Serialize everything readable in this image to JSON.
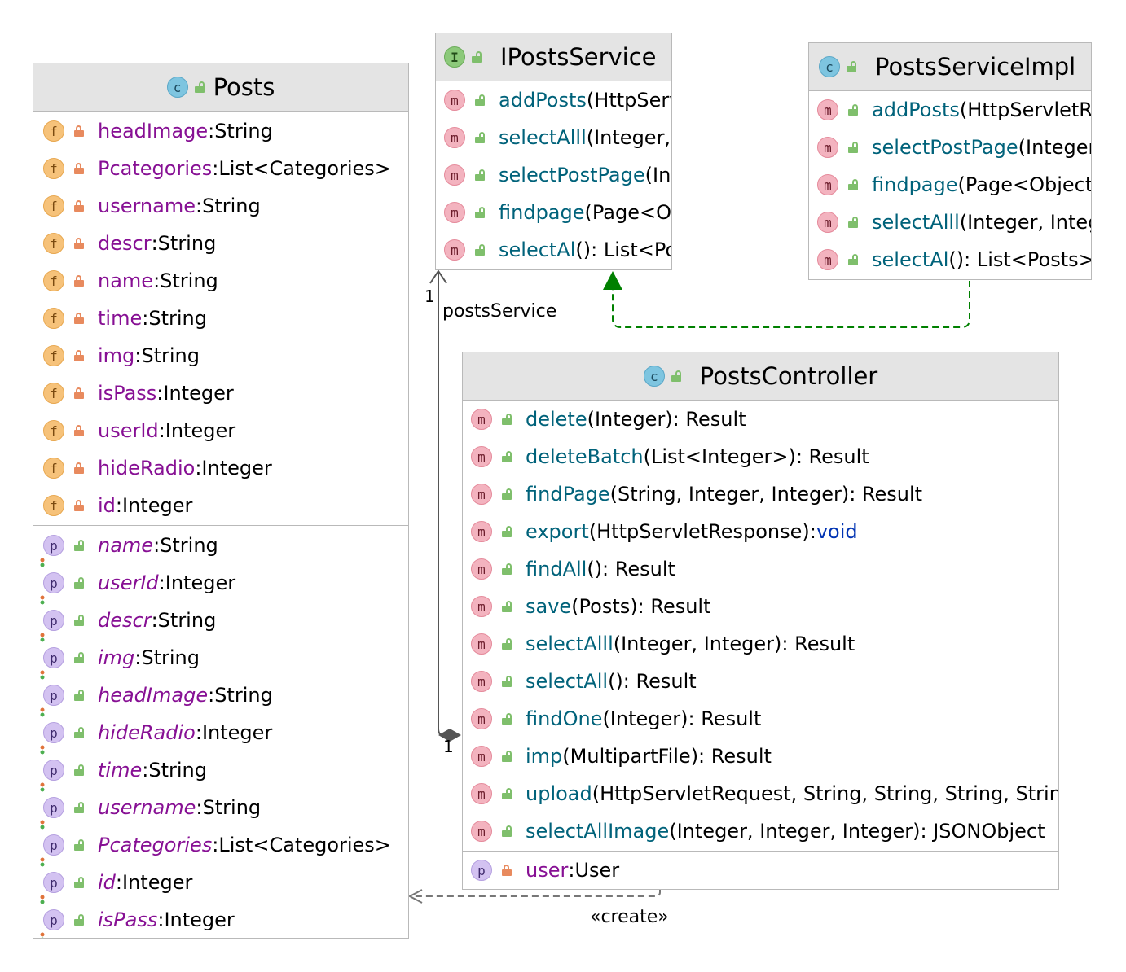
{
  "posts": {
    "name": "Posts",
    "fields": [
      {
        "name": "headImage",
        "type": "String"
      },
      {
        "name": "Pcategories",
        "type": "List<Categories>"
      },
      {
        "name": "username",
        "type": "String"
      },
      {
        "name": "descr",
        "type": "String"
      },
      {
        "name": "name",
        "type": "String"
      },
      {
        "name": "time",
        "type": "String"
      },
      {
        "name": "img",
        "type": "String"
      },
      {
        "name": "isPass",
        "type": "Integer"
      },
      {
        "name": "userId",
        "type": "Integer"
      },
      {
        "name": "hideRadio",
        "type": "Integer"
      },
      {
        "name": "id",
        "type": "Integer"
      }
    ],
    "properties": [
      {
        "name": "name",
        "type": "String"
      },
      {
        "name": "userId",
        "type": "Integer"
      },
      {
        "name": "descr",
        "type": "String"
      },
      {
        "name": "img",
        "type": "String"
      },
      {
        "name": "headImage",
        "type": "String"
      },
      {
        "name": "hideRadio",
        "type": "Integer"
      },
      {
        "name": "time",
        "type": "String"
      },
      {
        "name": "username",
        "type": "String"
      },
      {
        "name": "Pcategories",
        "type": "List<Categories>"
      },
      {
        "name": "id",
        "type": "Integer"
      },
      {
        "name": "isPass",
        "type": "Integer"
      }
    ]
  },
  "iposts_service": {
    "name": "IPostsService",
    "methods": [
      {
        "name": "addPosts",
        "sig": "(HttpServ"
      },
      {
        "name": "selectAlll",
        "sig": "(Integer,"
      },
      {
        "name": "selectPostPage",
        "sig": "(Int"
      },
      {
        "name": "findpage",
        "sig": "(Page<O"
      },
      {
        "name": "selectAl",
        "sig": "():  List<Po"
      }
    ]
  },
  "posts_service_impl": {
    "name": "PostsServiceImpl",
    "methods": [
      {
        "name": "addPosts",
        "sig": "(HttpServletR"
      },
      {
        "name": "selectPostPage",
        "sig": "(Integer"
      },
      {
        "name": "findpage",
        "sig": "(Page<Object"
      },
      {
        "name": "selectAlll",
        "sig": "(Integer, Integ"
      },
      {
        "name": "selectAl",
        "sig": "():  List<Posts>"
      }
    ]
  },
  "posts_controller": {
    "name": "PostsController",
    "methods": [
      {
        "name": "delete",
        "sig": "(Integer):  Result"
      },
      {
        "name": "deleteBatch",
        "sig": "(List<Integer>):  Result"
      },
      {
        "name": "findPage",
        "sig": "(String, Integer, Integer):  Result"
      },
      {
        "name": "export",
        "sig": "(HttpServletResponse):  ",
        "ret_kw": "void"
      },
      {
        "name": "findAll",
        "sig": "():  Result"
      },
      {
        "name": "save",
        "sig": "(Posts):  Result"
      },
      {
        "name": "selectAlll",
        "sig": "(Integer, Integer):  Result"
      },
      {
        "name": "selectAll",
        "sig": "():  Result"
      },
      {
        "name": "findOne",
        "sig": "(Integer):  Result"
      },
      {
        "name": "imp",
        "sig": "(MultipartFile):  Result"
      },
      {
        "name": "upload",
        "sig": "(HttpServletRequest, String, String, String, String,"
      },
      {
        "name": "selectAllImage",
        "sig": "(Integer, Integer, Integer):  JSONObject"
      }
    ],
    "fields": [
      {
        "name": "user",
        "type": "User"
      }
    ]
  },
  "edges": {
    "assoc_label": "postsService",
    "assoc_mult_top": "1",
    "assoc_mult_bottom": "1",
    "create_label": "«create»"
  },
  "icons": {
    "class": "c",
    "interface": "I",
    "field": "f",
    "method": "m",
    "property": "p"
  },
  "colors": {
    "field_name": "#871094",
    "method_name": "#00627a",
    "keyword": "#0033b3",
    "header_bg": "#e4e4e4",
    "realization_arrow": "#008000"
  }
}
